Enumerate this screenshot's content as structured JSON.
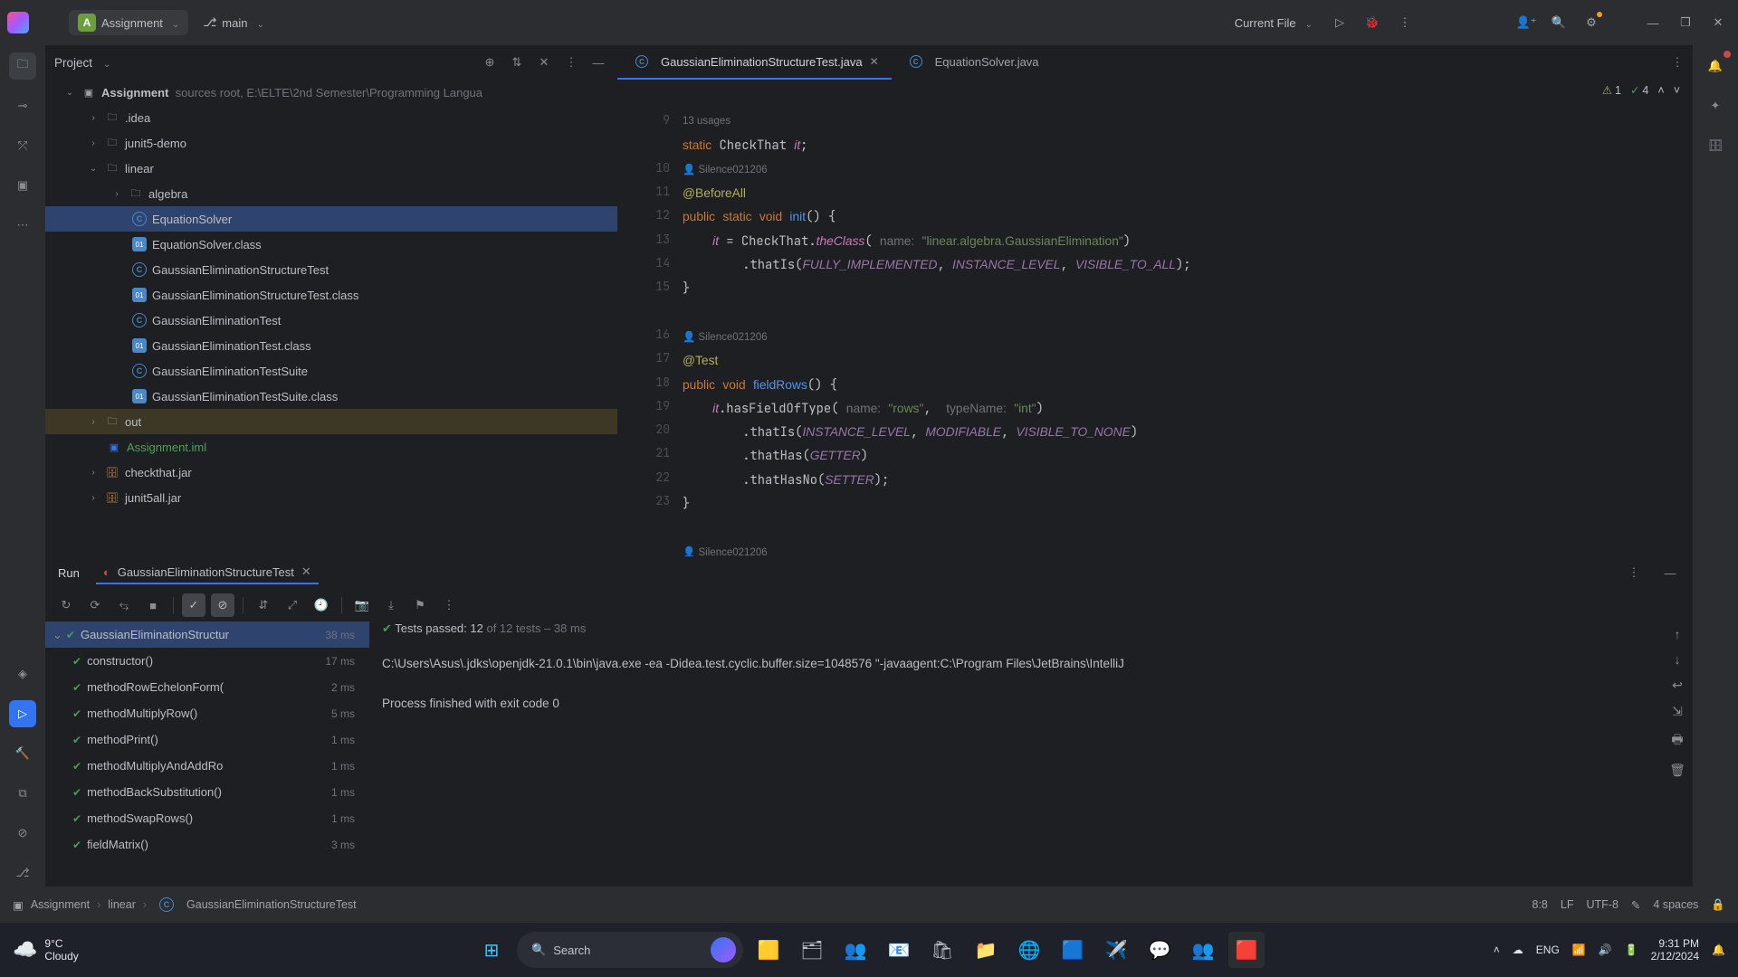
{
  "topbar": {
    "badge_letter": "A",
    "project_name": "Assignment",
    "branch": "main",
    "run_config": "Current File"
  },
  "project_panel": {
    "title": "Project",
    "root": "Assignment",
    "root_hint": "sources root,  E:\\ELTE\\2nd Semester\\Programming Langua",
    "nodes": {
      "idea": ".idea",
      "junit5": "junit5-demo",
      "linear": "linear",
      "algebra": "algebra",
      "eq_solver": "EquationSolver",
      "eq_solver_cls": "EquationSolver.class",
      "gest": "GaussianEliminationStructureTest",
      "gest_cls": "GaussianEliminationStructureTest.class",
      "get": "GaussianEliminationTest",
      "get_cls": "GaussianEliminationTest.class",
      "gets": "GaussianEliminationTestSuite",
      "gets_cls": "GaussianEliminationTestSuite.class",
      "out": "out",
      "iml": "Assignment.iml",
      "chk": "checkthat.jar",
      "jall": "junit5all.jar"
    }
  },
  "tabs": {
    "t1": "GaussianEliminationStructureTest.java",
    "t2": "EquationSolver.java"
  },
  "editor": {
    "usages": "13 usages",
    "author1": "Silence021206",
    "author2": "Silence021206",
    "author3": "Silence021206",
    "insp_warn": "1",
    "insp_typo": "4",
    "hint_name": "name:",
    "hint_type": "typeName:"
  },
  "gutter": [
    "",
    "9",
    "",
    "10",
    "11",
    "12",
    "13",
    "14",
    "15",
    "",
    "16",
    "17",
    "18",
    "19",
    "20",
    "21",
    "22",
    "23",
    ""
  ],
  "run": {
    "title": "Run",
    "cfg": "GaussianEliminationStructureTest",
    "passed_label": "Tests passed: 12",
    "passed_of": "of 12 tests",
    "passed_time": "– 38 ms",
    "console1": "C:\\Users\\Asus\\.jdks\\openjdk-21.0.1\\bin\\java.exe -ea -Didea.test.cyclic.buffer.size=1048576 \"-javaagent:C:\\Program Files\\JetBrains\\IntelliJ",
    "console2": "Process finished with exit code 0",
    "tests": [
      {
        "name": "GaussianEliminationStructur",
        "time": "38 ms",
        "root": true
      },
      {
        "name": "constructor()",
        "time": "17 ms"
      },
      {
        "name": "methodRowEchelonForm(",
        "time": "2 ms"
      },
      {
        "name": "methodMultiplyRow()",
        "time": "5 ms"
      },
      {
        "name": "methodPrint()",
        "time": "1 ms"
      },
      {
        "name": "methodMultiplyAndAddRo",
        "time": "1 ms"
      },
      {
        "name": "methodBackSubstitution()",
        "time": "1 ms"
      },
      {
        "name": "methodSwapRows()",
        "time": "1 ms"
      },
      {
        "name": "fieldMatrix()",
        "time": "3 ms"
      }
    ]
  },
  "status": {
    "c1": "Assignment",
    "c2": "linear",
    "c3": "GaussianEliminationStructureTest",
    "pos": "8:8",
    "le": "LF",
    "enc": "UTF-8",
    "indent": "4 spaces"
  },
  "taskbar": {
    "temp": "9°C",
    "cond": "Cloudy",
    "search": "Search",
    "lang": "ENG",
    "time": "9:31 PM",
    "date": "2/12/2024"
  }
}
